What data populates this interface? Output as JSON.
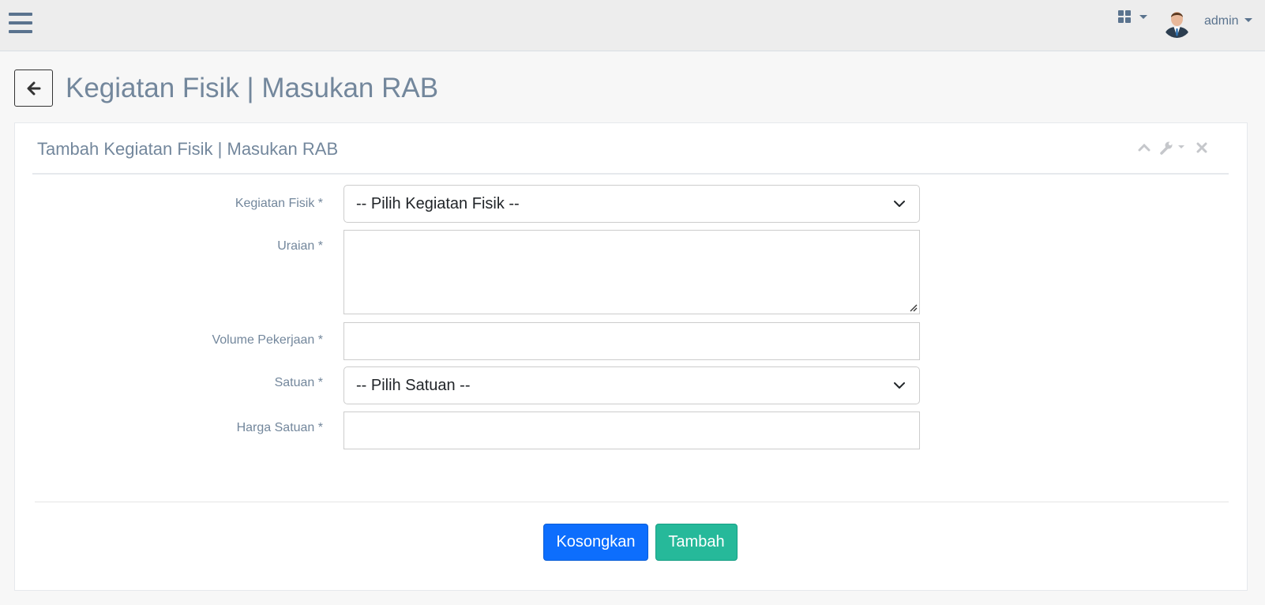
{
  "topnav": {
    "menu_icon": "hamburger-icon",
    "apps_icon": "grid-icon",
    "user": {
      "name": "admin",
      "avatar": "avatar-image"
    }
  },
  "page": {
    "back_icon": "arrow-left-icon",
    "title": "Kegiatan Fisik | Masukan RAB"
  },
  "panel": {
    "title": "Tambah Kegiatan Fisik | Masukan RAB",
    "tools": [
      "chevron-up-icon",
      "wrench-icon",
      "close-icon"
    ]
  },
  "form": {
    "kegiatan_fisik": {
      "label": "Kegiatan Fisik *",
      "selected": "-- Pilih Kegiatan Fisik --"
    },
    "uraian": {
      "label": "Uraian *",
      "value": ""
    },
    "volume": {
      "label": "Volume Pekerjaan *",
      "value": ""
    },
    "satuan": {
      "label": "Satuan *",
      "selected": "-- Pilih Satuan --"
    },
    "harga": {
      "label": "Harga Satuan *",
      "value": ""
    }
  },
  "actions": {
    "reset_label": "Kosongkan",
    "submit_label": "Tambah"
  },
  "colors": {
    "primary": "#0d6efd",
    "success": "#26b99a",
    "text": "#73879c",
    "navbar": "#ededed"
  }
}
